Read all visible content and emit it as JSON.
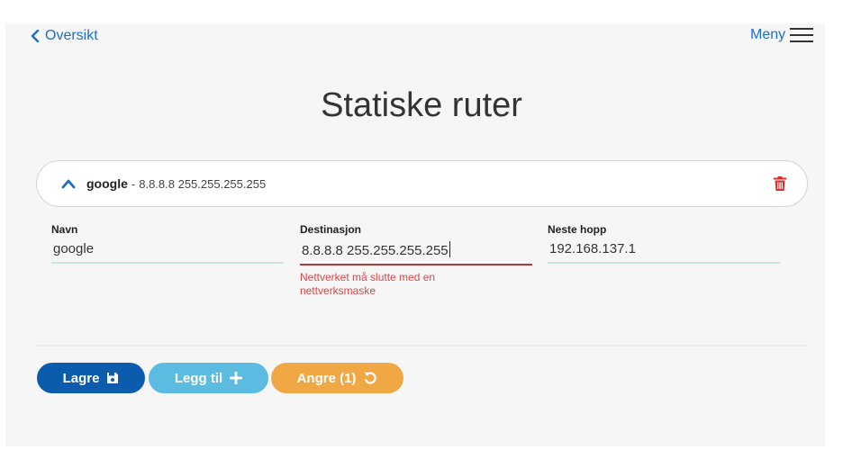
{
  "nav": {
    "back_label": "Oversikt",
    "menu_label": "Meny"
  },
  "page": {
    "title": "Statiske ruter"
  },
  "route": {
    "name": "google",
    "separator": "-",
    "destination_summary": "8.8.8.8 255.255.255.255",
    "expanded": true,
    "fields": {
      "name": {
        "label": "Navn",
        "value": "google"
      },
      "destination": {
        "label": "Destinasjon",
        "value": "8.8.8.8 255.255.255.255",
        "error": "Nettverket må slutte med en nettverksmaske"
      },
      "next_hop": {
        "label": "Neste hopp",
        "value": "192.168.137.1"
      }
    }
  },
  "actions": {
    "save_label": "Lagre",
    "add_label": "Legg til",
    "undo_label": "Angre (1)"
  },
  "colors": {
    "link": "#1d6fc4",
    "save": "#0b5cad",
    "add": "#5bbbe0",
    "undo": "#f0a845",
    "error": "#d34a4a",
    "delete": "#d9302c"
  },
  "icons": {
    "back": "chevron-left-icon",
    "menu": "hamburger-menu-icon",
    "collapse": "chevron-up-icon",
    "delete": "trash-icon",
    "save": "floppy-disk-icon",
    "add": "plus-icon",
    "undo": "undo-icon"
  }
}
